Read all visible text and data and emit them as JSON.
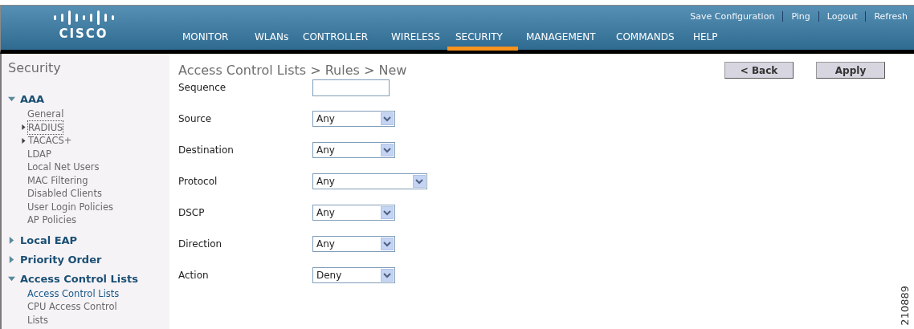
{
  "header": {
    "logo": "CISCO",
    "top_links": [
      "Save Configuration",
      "Ping",
      "Logout",
      "Refresh"
    ],
    "tabs": [
      {
        "label": "MONITOR",
        "selected": false
      },
      {
        "label": "WLANs",
        "selected": false
      },
      {
        "label": "CONTROLLER",
        "selected": false
      },
      {
        "label": "WIRELESS",
        "selected": false
      },
      {
        "label": "SECURITY",
        "selected": true
      },
      {
        "label": "MANAGEMENT",
        "selected": false
      },
      {
        "label": "COMMANDS",
        "selected": false
      },
      {
        "label": "HELP",
        "selected": false
      }
    ]
  },
  "sidebar": {
    "title": "Security",
    "sections": [
      {
        "label": "AAA",
        "expanded": true,
        "children": [
          {
            "label": "General",
            "expandable": false,
            "focused": false,
            "selected": false
          },
          {
            "label": "RADIUS",
            "expandable": true,
            "focused": true,
            "selected": false
          },
          {
            "label": "TACACS+",
            "expandable": true,
            "focused": false,
            "selected": false
          },
          {
            "label": "LDAP",
            "expandable": false,
            "focused": false,
            "selected": false
          },
          {
            "label": "Local Net Users",
            "expandable": false,
            "focused": false,
            "selected": false
          },
          {
            "label": "MAC Filtering",
            "expandable": false,
            "focused": false,
            "selected": false
          },
          {
            "label": "Disabled Clients",
            "expandable": false,
            "focused": false,
            "selected": false
          },
          {
            "label": "User Login Policies",
            "expandable": false,
            "focused": false,
            "selected": false
          },
          {
            "label": "AP Policies",
            "expandable": false,
            "focused": false,
            "selected": false
          }
        ]
      },
      {
        "label": "Local EAP",
        "expanded": false
      },
      {
        "label": "Priority Order",
        "expanded": false
      },
      {
        "label": "Access Control Lists",
        "expanded": true,
        "children": [
          {
            "label": "Access Control Lists",
            "expandable": false,
            "focused": false,
            "selected": true
          },
          {
            "label": "CPU Access Control Lists",
            "expandable": false,
            "focused": false,
            "selected": false
          }
        ]
      }
    ]
  },
  "content": {
    "title": "Access Control Lists > Rules > New",
    "buttons": [
      "< Back",
      "Apply"
    ],
    "fields": [
      {
        "label": "Sequence",
        "kind": "text"
      },
      {
        "label": "Source",
        "kind": "select",
        "value": "Any",
        "wide": false
      },
      {
        "label": "Destination",
        "kind": "select",
        "value": "Any",
        "wide": false
      },
      {
        "label": "Protocol",
        "kind": "select",
        "value": "Any",
        "wide": true
      },
      {
        "label": "DSCP",
        "kind": "select",
        "value": "Any",
        "wide": false
      },
      {
        "label": "Direction",
        "kind": "select",
        "value": "Any",
        "wide": false
      },
      {
        "label": "Action",
        "kind": "select",
        "value": "Deny",
        "wide": false
      }
    ]
  },
  "figure_id": "210889"
}
